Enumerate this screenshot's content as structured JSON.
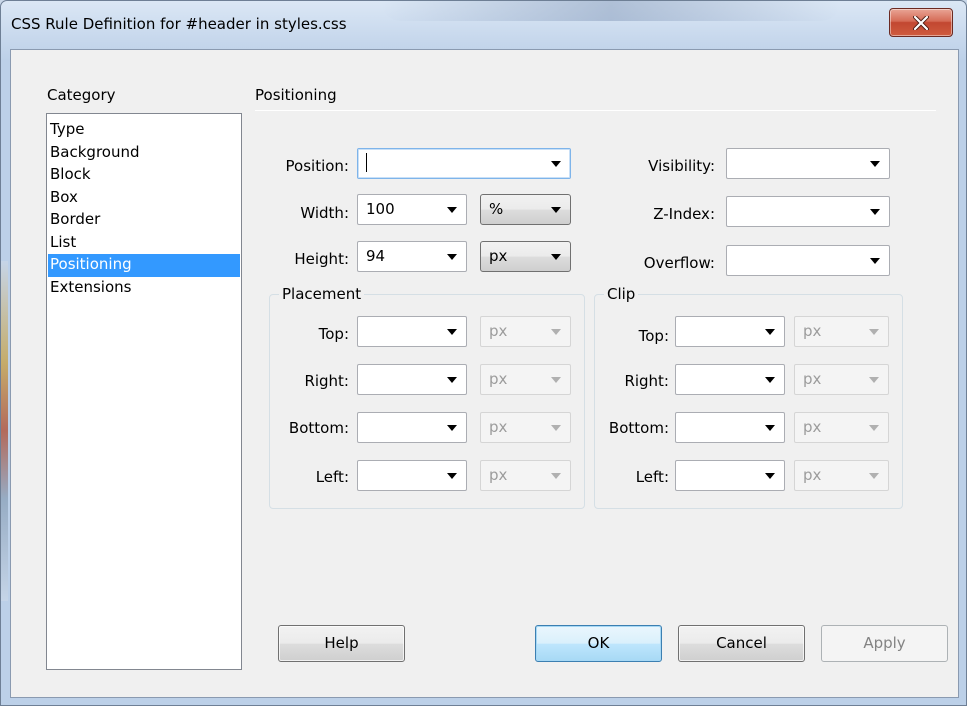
{
  "window": {
    "title": "CSS Rule Definition for #header in styles.css"
  },
  "sidebar": {
    "heading": "Category",
    "items": [
      {
        "label": "Type"
      },
      {
        "label": "Background"
      },
      {
        "label": "Block"
      },
      {
        "label": "Box"
      },
      {
        "label": "Border"
      },
      {
        "label": "List"
      },
      {
        "label": "Positioning",
        "selected": true
      },
      {
        "label": "Extensions"
      }
    ]
  },
  "main": {
    "heading": "Positioning",
    "position": {
      "label": "Position:",
      "value": ""
    },
    "width": {
      "label": "Width:",
      "value": "100",
      "unit": "%"
    },
    "height": {
      "label": "Height:",
      "value": "94",
      "unit": "px"
    },
    "visibility": {
      "label": "Visibility:",
      "value": ""
    },
    "z_index": {
      "label": "Z-Index:",
      "value": ""
    },
    "overflow": {
      "label": "Overflow:",
      "value": ""
    },
    "placement": {
      "title": "Placement",
      "top": {
        "label": "Top:",
        "value": "",
        "unit": "px"
      },
      "right": {
        "label": "Right:",
        "value": "",
        "unit": "px"
      },
      "bottom": {
        "label": "Bottom:",
        "value": "",
        "unit": "px"
      },
      "left": {
        "label": "Left:",
        "value": "",
        "unit": "px"
      }
    },
    "clip": {
      "title": "Clip",
      "top": {
        "label": "Top:",
        "value": "",
        "unit": "px"
      },
      "right": {
        "label": "Right:",
        "value": "",
        "unit": "px"
      },
      "bottom": {
        "label": "Bottom:",
        "value": "",
        "unit": "px"
      },
      "left": {
        "label": "Left:",
        "value": "",
        "unit": "px"
      }
    }
  },
  "buttons": {
    "help": "Help",
    "ok": "OK",
    "cancel": "Cancel",
    "apply": "Apply"
  },
  "colors": {
    "selection": "#3399ff",
    "close_button": "#c24731"
  },
  "icons": {
    "close": "close-icon",
    "dropdown": "chevron-down-icon"
  }
}
